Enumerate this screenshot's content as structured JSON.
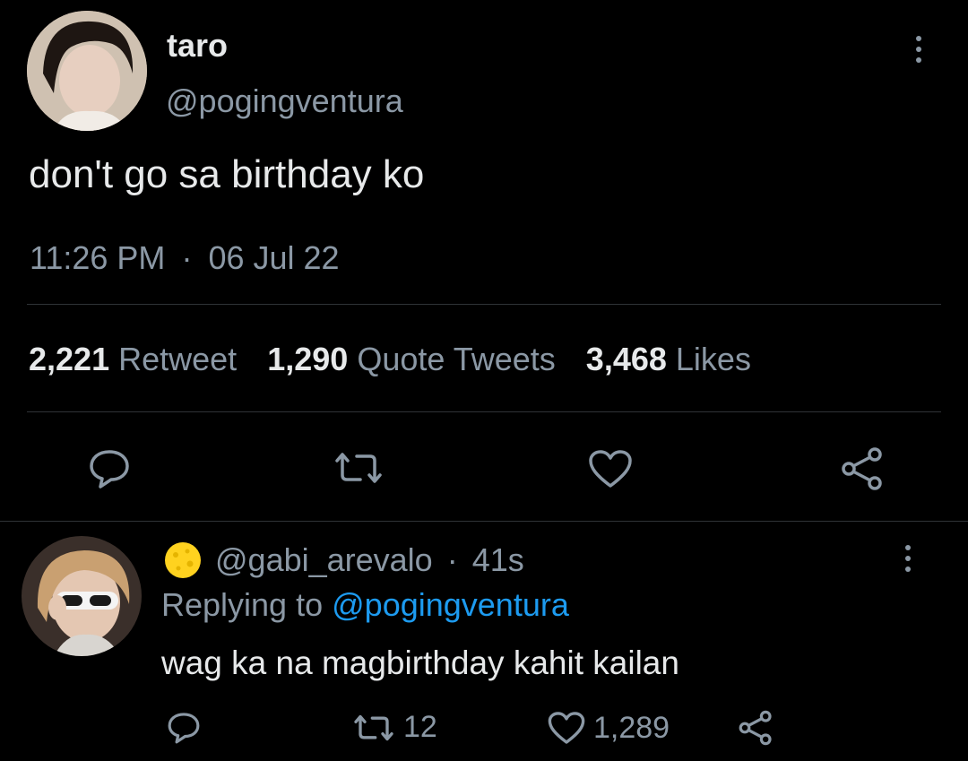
{
  "tweet": {
    "display_name": "taro",
    "handle": "@pogingventura",
    "text": "don't go sa birthday ko",
    "time": "11:26 PM",
    "separator": "·",
    "date": "06 Jul 22",
    "stats": {
      "retweets_count": "2,221",
      "retweets_label": "Retweet",
      "quotes_count": "1,290",
      "quotes_label": "Quote Tweets",
      "likes_count": "3,468",
      "likes_label": "Likes"
    }
  },
  "reply": {
    "handle": "@gabi_arevalo",
    "separator": "·",
    "age": "41s",
    "replying_label": "Replying to",
    "replying_handle": "@pogingventura",
    "text": "wag ka na magbirthday kahit kailan",
    "retweet_count": "12",
    "like_count": "1,289"
  },
  "icons": {
    "reply": "reply-icon",
    "retweet": "retweet-icon",
    "like": "heart-icon",
    "share": "share-icon",
    "more": "more-options-icon",
    "emoji": "moon-emoji-icon"
  },
  "colors": {
    "background": "#000000",
    "text": "#e7e9ea",
    "muted": "#8b98a5",
    "link": "#1d9bf0",
    "divider": "#2f3336"
  }
}
